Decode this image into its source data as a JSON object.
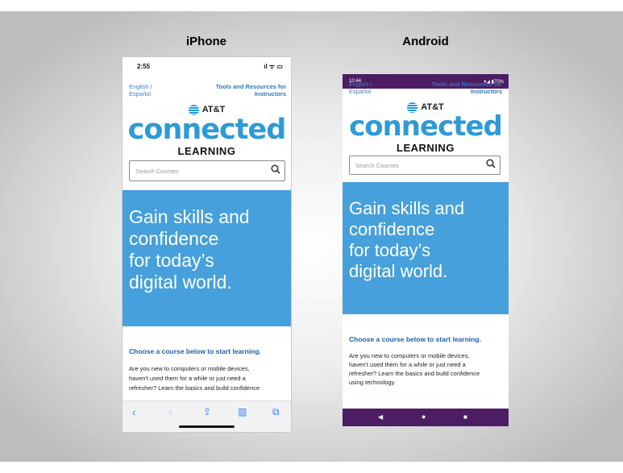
{
  "iphone": {
    "title": "iPhone",
    "status_time": "2:55",
    "status_icons": "ıl ᯤ ▭",
    "lang_line1": "English I",
    "lang_line2": "Español",
    "tools_line1": "Tools and Resources for",
    "tools_line2": "Instructors",
    "att": "AT&T",
    "connected": "connected",
    "learning": "LEARNING",
    "search_placeholder": "Search Courses",
    "hero_lines": [
      "Gain skills and",
      "confidence",
      "for today’s",
      "digital world."
    ],
    "choose": "Choose a course below to start learning.",
    "body_lines": [
      "Are you new to computers or mobile devices,",
      "haven't used them for a while or just need a",
      "refresher? Learn the basics and build confidence"
    ],
    "toolbar": {
      "back": "‹",
      "forward": "›",
      "share": "⇪",
      "bookmarks": "▥",
      "tabs": "⧉"
    }
  },
  "android": {
    "title": "Android",
    "status_time": "10:44",
    "status_right": "▾◢ ▮70%",
    "lang_line1": "English I",
    "lang_line2": "Español",
    "tools_line1": "Tools and Resources for",
    "tools_line2": "Instructors",
    "att": "AT&T",
    "connected": "connected",
    "learning": "LEARNING",
    "search_placeholder": "Search Courses",
    "hero_lines": [
      "Gain skills and",
      "confidence",
      "for today’s",
      "digital world."
    ],
    "choose": "Choose a course below to start learning.",
    "body_lines": [
      "Are you new to computers or mobile devices,",
      "haven't used them for a while or just need a",
      "refresher? Learn the basics and build confidence",
      "using technology."
    ],
    "nav": {
      "back": "◀",
      "home": "●",
      "recents": "■"
    }
  },
  "colors": {
    "brand_blue": "#2e9ad6",
    "hero_blue": "#46a0db",
    "android_purple": "#4c1d63",
    "link_blue": "#2e76b9"
  }
}
